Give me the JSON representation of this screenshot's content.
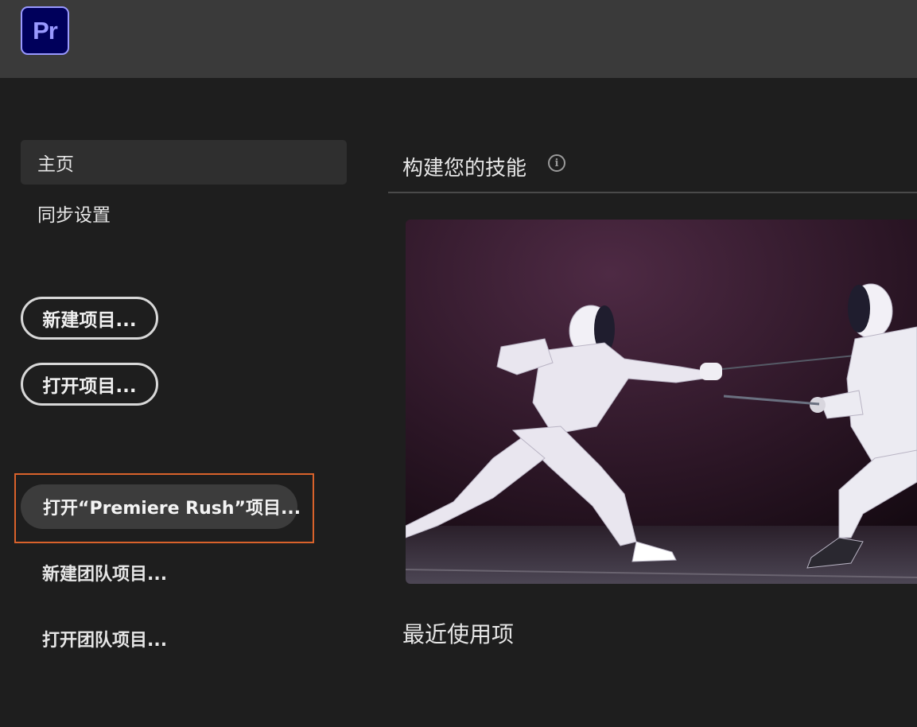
{
  "app": {
    "logo_text": "Pr",
    "logo_color": "#00005b",
    "logo_text_color": "#9999ff"
  },
  "sidebar": {
    "nav_items": [
      {
        "label": "主页",
        "active": true
      },
      {
        "label": "同步设置",
        "active": false
      }
    ],
    "buttons": {
      "new_project": "新建项目...",
      "open_project": "打开项目...",
      "open_rush_project": "打开“Premiere Rush”项目...",
      "new_team_project": "新建团队项目...",
      "open_team_project": "打开团队项目..."
    },
    "highlight_color": "#d9622b"
  },
  "main": {
    "skills_title": "构建您的技能",
    "info_icon": "info-icon",
    "hero_image": "fencing-duel-photo",
    "recent_title": "最近使用项"
  }
}
